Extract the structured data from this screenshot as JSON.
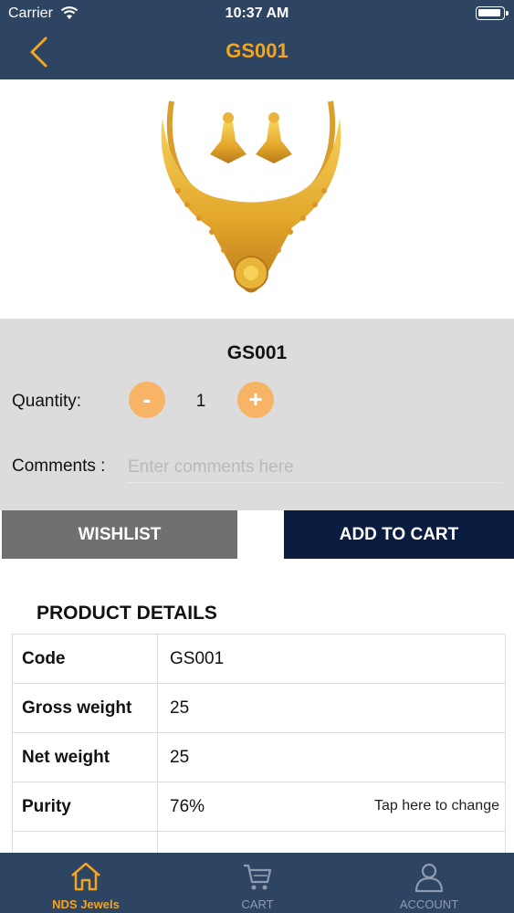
{
  "status_bar": {
    "carrier": "Carrier",
    "time": "10:37 AM"
  },
  "nav": {
    "title": "GS001"
  },
  "product": {
    "name": "GS001",
    "quantity_label": "Quantity:",
    "quantity_value": "1",
    "minus_label": "-",
    "plus_label": "+",
    "comments_label": "Comments :",
    "comments_placeholder": "Enter comments here"
  },
  "actions": {
    "wishlist": "WISHLIST",
    "add_to_cart": "ADD TO CART"
  },
  "details": {
    "title": "PRODUCT DETAILS",
    "rows": [
      {
        "key": "Code",
        "value": "GS001"
      },
      {
        "key": "Gross weight",
        "value": "25"
      },
      {
        "key": "Net weight",
        "value": "25"
      },
      {
        "key": "Purity",
        "value": "76%",
        "action": "Tap here to change"
      }
    ]
  },
  "tabbar": {
    "items": [
      {
        "label": "NDS Jewels",
        "icon": "home-icon",
        "active": true
      },
      {
        "label": "CART",
        "icon": "cart-icon",
        "active": false
      },
      {
        "label": "ACCOUNT",
        "icon": "account-icon",
        "active": false
      }
    ]
  },
  "colors": {
    "nav_bg": "#2d4463",
    "accent": "#f3a51d",
    "cart_button": "#0a1d40",
    "wishlist_button": "#707070",
    "qty_button": "#f8b466"
  }
}
